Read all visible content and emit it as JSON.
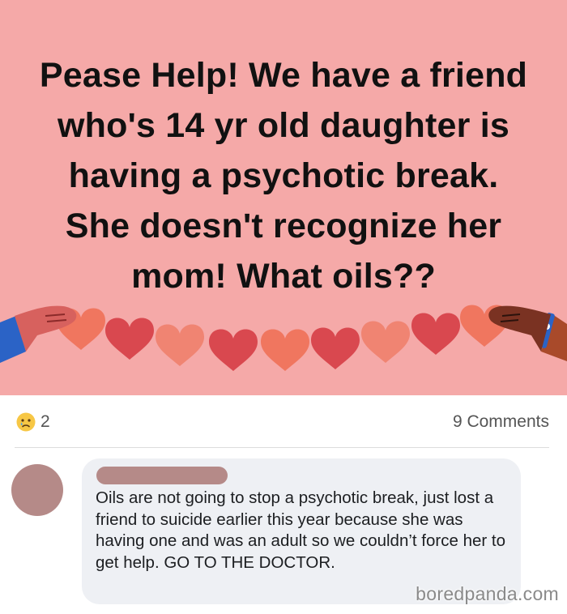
{
  "post": {
    "text": "Pease Help! We have a friend who's 14 yr old daughter is having a psychotic break. She doesn't recognize her mom! What oils??",
    "background_color": "#f5a9a8"
  },
  "stats": {
    "reaction_icon": "crying-face-icon",
    "reaction_count": "2",
    "comments_label": "9 Comments"
  },
  "comment": {
    "text": "Oils are not going to stop a psychotic break, just lost a friend to suicide earlier this year because she was having one and was an adult so we couldn’t force her to get help. GO TO THE DOCTOR."
  },
  "watermark": "boredpanda.com",
  "colors": {
    "redaction": "#b58a88",
    "bubble": "#eef0f4"
  }
}
